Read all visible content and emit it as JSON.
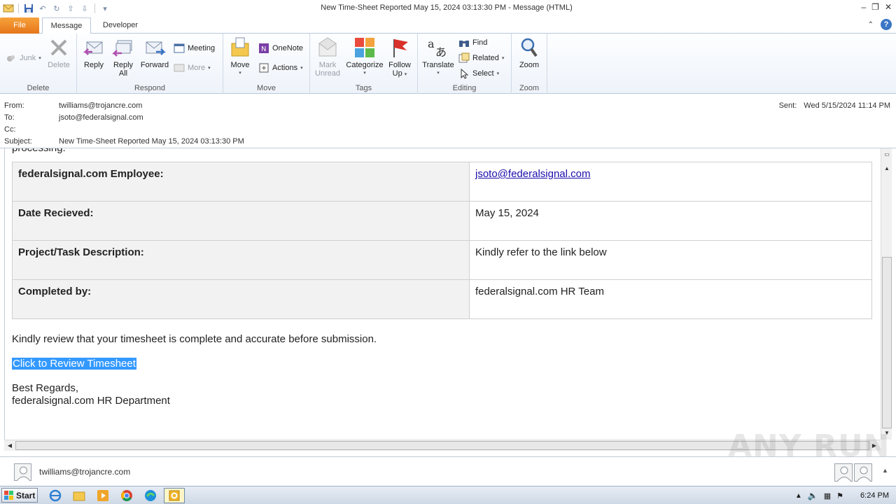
{
  "window": {
    "title": "New Time-Sheet Reported May 15, 2024 03:13:30 PM  -  Message (HTML)"
  },
  "tabs": [
    {
      "label": "File"
    },
    {
      "label": "Message"
    },
    {
      "label": "Developer"
    }
  ],
  "ribbon": {
    "delete_group": {
      "label": "Delete",
      "junk": "Junk",
      "delete": "Delete"
    },
    "respond_group": {
      "label": "Respond",
      "reply": "Reply",
      "reply_all_1": "Reply",
      "reply_all_2": "All",
      "forward": "Forward",
      "meeting": "Meeting",
      "more": "More"
    },
    "move_group": {
      "label": "Move",
      "move": "Move",
      "onenote": "OneNote",
      "actions": "Actions"
    },
    "tags_group": {
      "label": "Tags",
      "mark_unread_1": "Mark",
      "mark_unread_2": "Unread",
      "categorize": "Categorize",
      "follow_up_1": "Follow",
      "follow_up_2": "Up"
    },
    "editing_group": {
      "label": "Editing",
      "translate": "Translate",
      "find": "Find",
      "related": "Related",
      "select": "Select"
    },
    "zoom_group": {
      "label": "Zoom",
      "zoom": "Zoom"
    }
  },
  "header": {
    "from_label": "From:",
    "from": "twilliams@trojancre.com",
    "to_label": "To:",
    "to": "jsoto@federalsignal.com",
    "cc_label": "Cc:",
    "cc": "",
    "subject_label": "Subject:",
    "subject": "New Time-Sheet Reported May 15, 2024 03:13:30 PM",
    "sent_label": "Sent:",
    "sent": "Wed 5/15/2024 11:14 PM"
  },
  "message": {
    "clipped_line": "processing.",
    "table": [
      {
        "key": "federalsignal.com Employee:",
        "value": "jsoto@federalsignal.com"
      },
      {
        "key": "Date Recieved:",
        "value": "May 15, 2024"
      },
      {
        "key": "Project/Task Description:",
        "value": "Kindly refer to the link below"
      },
      {
        "key": "Completed by:",
        "value": "federalsignal.com HR Team"
      }
    ],
    "review_text": "Kindly review that your timesheet is complete and accurate before submission.",
    "link_text": "Click to Review Timesheet",
    "closing": "Best Regards,",
    "signature": "federalsignal.com HR Department"
  },
  "people_pane": {
    "name": "twilliams@trojancre.com"
  },
  "taskbar": {
    "start": "Start",
    "clock": "6:24 PM"
  },
  "watermark": "ANY RUN",
  "colors": {
    "file_tab": "#e5761b",
    "selection": "#3399ff",
    "link": "#1a0dab",
    "help": "#3b75c5"
  }
}
